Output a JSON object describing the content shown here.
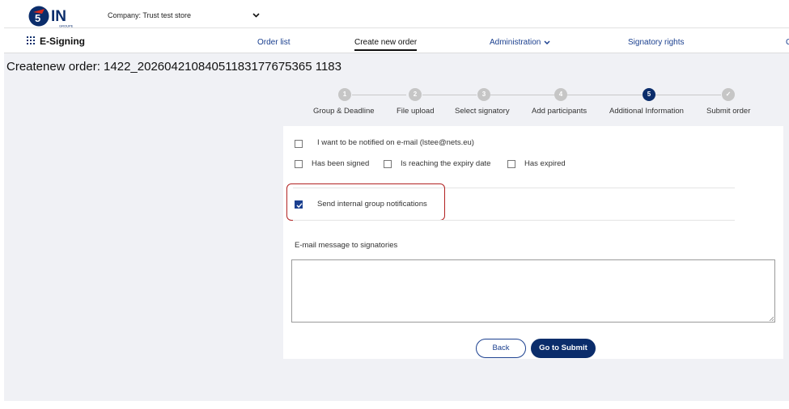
{
  "header": {
    "logo_text": "IN",
    "logo_sub": "GROUPE",
    "company": "Company: Trust test store"
  },
  "nav": {
    "app_name": "E-Signing",
    "items": [
      "Order list",
      "Create new order",
      "Administration",
      "Signatory rights"
    ],
    "active": "Create new order",
    "trailing_clipped": "C"
  },
  "page": {
    "title": "Create new order: 1422_20260421084051183177675365 1183"
  },
  "stepper": {
    "steps": [
      {
        "num": "1",
        "label": "Group & Deadline"
      },
      {
        "num": "2",
        "label": "File upload"
      },
      {
        "num": "3",
        "label": "Select signatory"
      },
      {
        "num": "4",
        "label": "Add participants"
      },
      {
        "num": "5",
        "label": "Additional Information"
      },
      {
        "num": "✓",
        "label": "Submit order"
      }
    ],
    "active_index": 4
  },
  "form": {
    "notify_email_label": "I want to be notified on e-mail (lstee@nets.eu)",
    "notify_email_checked": false,
    "events": [
      {
        "label": "Has been signed",
        "checked": false
      },
      {
        "label": "Is reaching the expiry date",
        "checked": false
      },
      {
        "label": "Has expired",
        "checked": false
      }
    ],
    "internal_group_label": "Send internal group notifications",
    "internal_group_checked": true,
    "email_message_label": "E-mail message to signatories",
    "email_message_value": ""
  },
  "buttons": {
    "back": "Back",
    "submit": "Go to Submit"
  },
  "colors": {
    "brand_navy": "#0b2d6b",
    "link_blue": "#1a3f8f",
    "highlight_red": "#b22222",
    "page_bg": "#f0f1f5"
  }
}
